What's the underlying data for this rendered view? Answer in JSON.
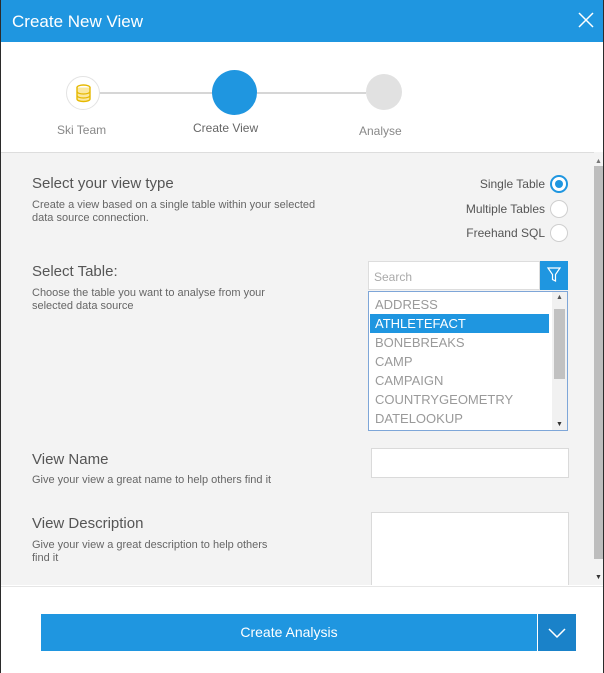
{
  "dialog": {
    "title": "Create New View",
    "accent": "#1f96e0"
  },
  "steps": [
    {
      "label": "Ski Team",
      "icon": "database-icon",
      "state": "done"
    },
    {
      "label": "Create View",
      "state": "active"
    },
    {
      "label": "Analyse",
      "state": "pending"
    }
  ],
  "view_type": {
    "title": "Select your view type",
    "desc": "Create a view based on a single table within your selected data source connection.",
    "options": [
      {
        "label": "Single Table",
        "checked": true
      },
      {
        "label": "Multiple Tables",
        "checked": false
      },
      {
        "label": "Freehand SQL",
        "checked": false
      }
    ]
  },
  "select_table": {
    "title": "Select Table:",
    "desc": "Choose the table you want to analyse from your selected data source",
    "search_placeholder": "Search",
    "items": [
      "ADDRESS",
      "ATHLETEFACT",
      "BONEBREAKS",
      "CAMP",
      "CAMPAIGN",
      "COUNTRYGEOMETRY",
      "DATELOOKUP"
    ],
    "selected": "ATHLETEFACT"
  },
  "view_name": {
    "title": "View Name",
    "desc": "Give your view a great name to help others find it",
    "value": ""
  },
  "view_description": {
    "title": "View Description",
    "desc": "Give your view a great description to help others find it",
    "value": ""
  },
  "footer": {
    "create_label": "Create Analysis"
  }
}
